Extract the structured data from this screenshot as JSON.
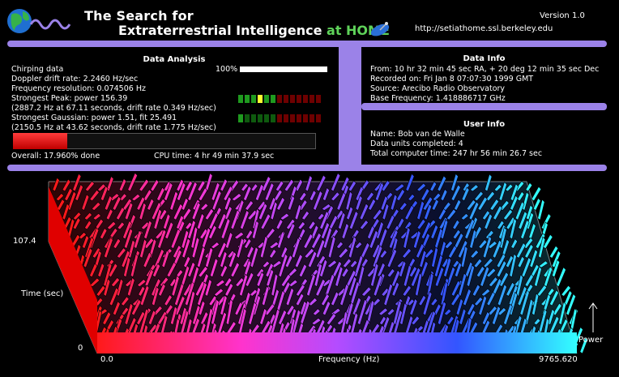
{
  "header": {
    "title_line1": "The Search for",
    "title_line2_main": "Extraterrestrial Intelligence",
    "title_line2_at": " at HOME",
    "version": "Version 1.0",
    "url": "http://setiathome.ssl.berkeley.edu"
  },
  "data_analysis": {
    "title": "Data Analysis",
    "chirping_label": "Chirping data",
    "chirping_pct": "100%",
    "chirping_fraction": 1.0,
    "doppler": "Doppler drift rate: 2.2460 Hz/sec",
    "resolution": "Frequency resolution: 0.074506 Hz",
    "peak": "Strongest Peak: power 156.39",
    "peak_detail": "(2887.2 Hz at 67.11 seconds, drift rate 0.349 Hz/sec)",
    "gaussian": "Strongest Gaussian: power  1.51, fit 25.491",
    "gaussian_detail": "(2150.5 Hz at 43.62 seconds, drift rate 1.775 Hz/sec)",
    "overall": "Overall: 17.960% done",
    "overall_fraction": 0.1796,
    "cpu_time": "CPU time: 4 hr 49 min 37.9 sec",
    "peak_meter": [
      "#1f9a1f",
      "#1f9a1f",
      "#1f9a1f",
      "#ffff33",
      "#1f9a1f",
      "#1f9a1f",
      "#6e0000",
      "#6e0000",
      "#6e0000",
      "#6e0000",
      "#6e0000",
      "#6e0000",
      "#6e0000"
    ],
    "gaussian_meter": [
      "#1f9a1f",
      "#0e5a0e",
      "#0e5a0e",
      "#0e5a0e",
      "#0e5a0e",
      "#0e5a0e",
      "#6e0000",
      "#6e0000",
      "#6e0000",
      "#6e0000",
      "#6e0000",
      "#6e0000",
      "#6e0000"
    ]
  },
  "data_info": {
    "title": "Data Info",
    "from": "From: 10 hr 32 min 45 sec RA, + 20 deg 12 min 35 sec Dec",
    "recorded": "Recorded on: Fri Jan  8 07:07:30 1999 GMT",
    "source": "Source: Arecibo Radio Observatory",
    "base_freq": "Base Frequency: 1.418886717 GHz"
  },
  "user_info": {
    "title": "User Info",
    "name": "Name: Bob van de Walle",
    "units": "Data units completed: 4",
    "total_time": "Total computer time: 247 hr 56 min 26.7 sec"
  },
  "graph": {
    "y_max": "107.4",
    "y_min": "0",
    "y_label": "Time (sec)",
    "x_min": "0.0",
    "x_max": "9765.620",
    "x_label": "Frequency (Hz)",
    "power_label": "Power"
  },
  "colors": {
    "frame": "#9b82e8",
    "home_green": "#5fd35a",
    "progress_red": "#ff2a2a"
  }
}
